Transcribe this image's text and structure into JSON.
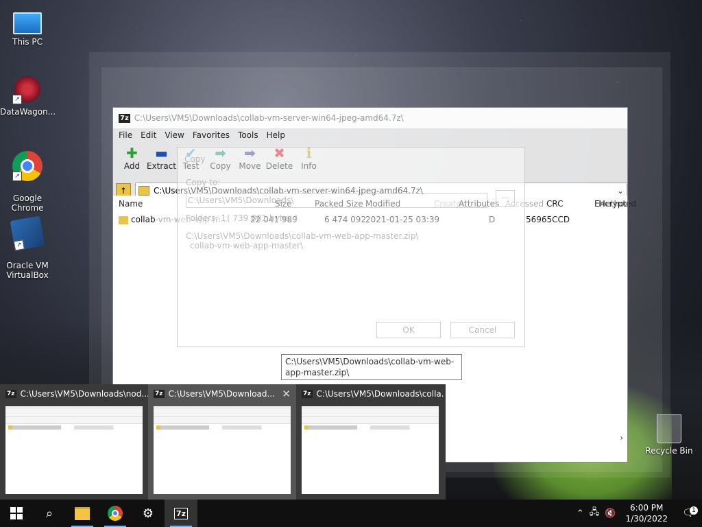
{
  "desktop": {
    "icons": [
      {
        "label": "This PC",
        "icon": "this-pc-icon"
      },
      {
        "label": "DataWagon...",
        "icon": "datawagon-icon"
      },
      {
        "label": "Google\nChrome",
        "icon": "chrome-icon"
      },
      {
        "label": "Oracle VM\nVirtualBox",
        "icon": "virtualbox-icon"
      },
      {
        "label": "Recycle Bin",
        "icon": "recycle-bin-icon"
      }
    ]
  },
  "window": {
    "title": "C:\\Users\\VM5\\Downloads\\collab-vm-server-win64-jpeg-amd64.7z\\",
    "app_badge": "7z",
    "menu": [
      "File",
      "Edit",
      "View",
      "Favorites",
      "Tools",
      "Help"
    ],
    "toolbar": [
      {
        "label": "Add",
        "icon": "add-icon",
        "color": "#2ca02c"
      },
      {
        "label": "Extract",
        "icon": "extract-icon",
        "color": "#1f4fb4"
      },
      {
        "label": "Test",
        "icon": "test-icon",
        "color": "#4aa8c8"
      },
      {
        "label": "Copy",
        "icon": "copy-icon",
        "color": "#3a9a8a"
      },
      {
        "label": "Move",
        "icon": "move-icon",
        "color": "#5a4aa8"
      },
      {
        "label": "Delete",
        "icon": "delete-icon",
        "color": "#d03030"
      },
      {
        "label": "Info",
        "icon": "info-icon",
        "color": "#c8a800"
      }
    ],
    "address": "C:\\Users\\VM5\\Downloads\\collab-vm-server-win64-jpeg-amd64.7z\\",
    "columns": [
      "Name",
      "Size",
      "Packed Size",
      "Modified",
      "Created",
      "Attributes",
      "Accessed",
      "CRC",
      "Encrypted",
      "Method"
    ],
    "rows": [
      {
        "name": "collab-vm-web-app-m...",
        "name_overlay": "collab",
        "size": "22 041 989",
        "packed": "6 474 092",
        "modified": "2021-01-25 03:39",
        "attributes": "D",
        "crc": "56965CCD"
      }
    ]
  },
  "copy_dialog": {
    "title": "Copy",
    "copy_to_label": "Copy to:",
    "path": "C:\\Users\\VM5\\Downloads\\",
    "folders": "Folders: 1",
    "size_info": "( 739 801 bytes )",
    "source_line1": "C:\\Users\\VM5\\Downloads\\collab-vm-web-app-master.zip\\",
    "source_line2": "collab-vm-web-app-master\\",
    "ok": "OK",
    "cancel": "Cancel"
  },
  "tooltip": "C:\\Users\\VM5\\Downloads\\collab-vm-web-app-master.zip\\",
  "thumbnails": [
    {
      "title": "C:\\Users\\VM5\\Downloads\\nod...",
      "active": false
    },
    {
      "title": "C:\\Users\\VM5\\Download...",
      "active": true
    },
    {
      "title": "C:\\Users\\VM5\\Downloads\\colla...",
      "active": false
    }
  ],
  "taskbar": {
    "clock_time": "6:00 PM",
    "clock_date": "1/30/2022",
    "notification_count": "1"
  }
}
